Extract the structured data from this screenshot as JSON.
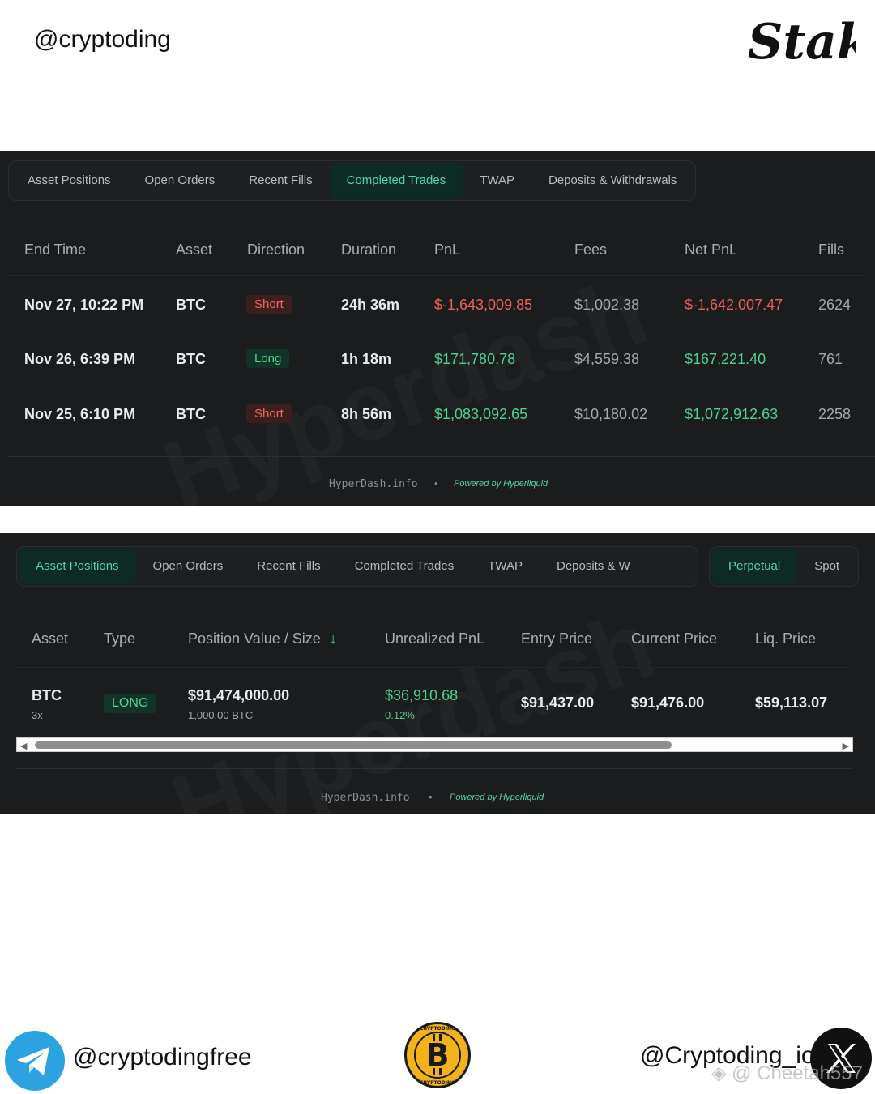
{
  "header": {
    "handle": "@cryptoding",
    "logo_text": "Stake"
  },
  "panel1": {
    "tabs": [
      "Asset Positions",
      "Open Orders",
      "Recent Fills",
      "Completed Trades",
      "TWAP",
      "Deposits & Withdrawals"
    ],
    "active_tab": "Completed Trades",
    "columns": [
      "End Time",
      "Asset",
      "Direction",
      "Duration",
      "PnL",
      "Fees",
      "Net PnL",
      "Fills"
    ],
    "rows": [
      {
        "end_time": "Nov 27, 10:22 PM",
        "asset": "BTC",
        "direction": "Short",
        "duration": "24h 36m",
        "pnl": "$-1,643,009.85",
        "fees": "$1,002.38",
        "net_pnl": "$-1,642,007.47",
        "fills": "2624"
      },
      {
        "end_time": "Nov 26, 6:39 PM",
        "asset": "BTC",
        "direction": "Long",
        "duration": "1h 18m",
        "pnl": "$171,780.78",
        "fees": "$4,559.38",
        "net_pnl": "$167,221.40",
        "fills": "761"
      },
      {
        "end_time": "Nov 25, 6:10 PM",
        "asset": "BTC",
        "direction": "Short",
        "duration": "8h 56m",
        "pnl": "$1,083,092.65",
        "fees": "$10,180.02",
        "net_pnl": "$1,072,912.63",
        "fills": "2258"
      }
    ],
    "footer": {
      "site": "HyperDash.info",
      "powered": "Powered by Hyperliquid"
    },
    "watermark": "Hyperdash"
  },
  "panel2": {
    "tabs": [
      "Asset Positions",
      "Open Orders",
      "Recent Fills",
      "Completed Trades",
      "TWAP",
      "Deposits & W"
    ],
    "active_tab": "Asset Positions",
    "toggle": [
      "Perpetual",
      "Spot"
    ],
    "active_toggle": "Perpetual",
    "columns": [
      "Asset",
      "Type",
      "Position Value / Size",
      "Unrealized PnL",
      "Entry Price",
      "Current Price",
      "Liq. Price"
    ],
    "sort_icon": "arrow-down-icon",
    "row": {
      "asset": "BTC",
      "leverage": "3x",
      "type": "LONG",
      "position_value": "$91,474,000.00",
      "size": "1,000.00 BTC",
      "unrealized_pnl": "$36,910.68",
      "unrealized_pct": "0.12%",
      "entry_price": "$91,437.00",
      "current_price": "$91,476.00",
      "liq_price": "$59,113.07"
    },
    "footer": {
      "site": "HyperDash.info",
      "powered": "Powered by Hyperliquid"
    },
    "watermark": "Hyperdash"
  },
  "bottom": {
    "telegram_handle": "@cryptodingfree",
    "coin_text_top": "CRYPTODING",
    "coin_text_bottom": "CRYPTODING",
    "x_handle": "@Cryptoding_io",
    "binance_watermark": "@ Cheetah557"
  },
  "colors": {
    "positive": "#4ad38f",
    "negative": "#e8605a",
    "accent": "#4fd6a4",
    "panel_bg": "#1b1c1d"
  }
}
